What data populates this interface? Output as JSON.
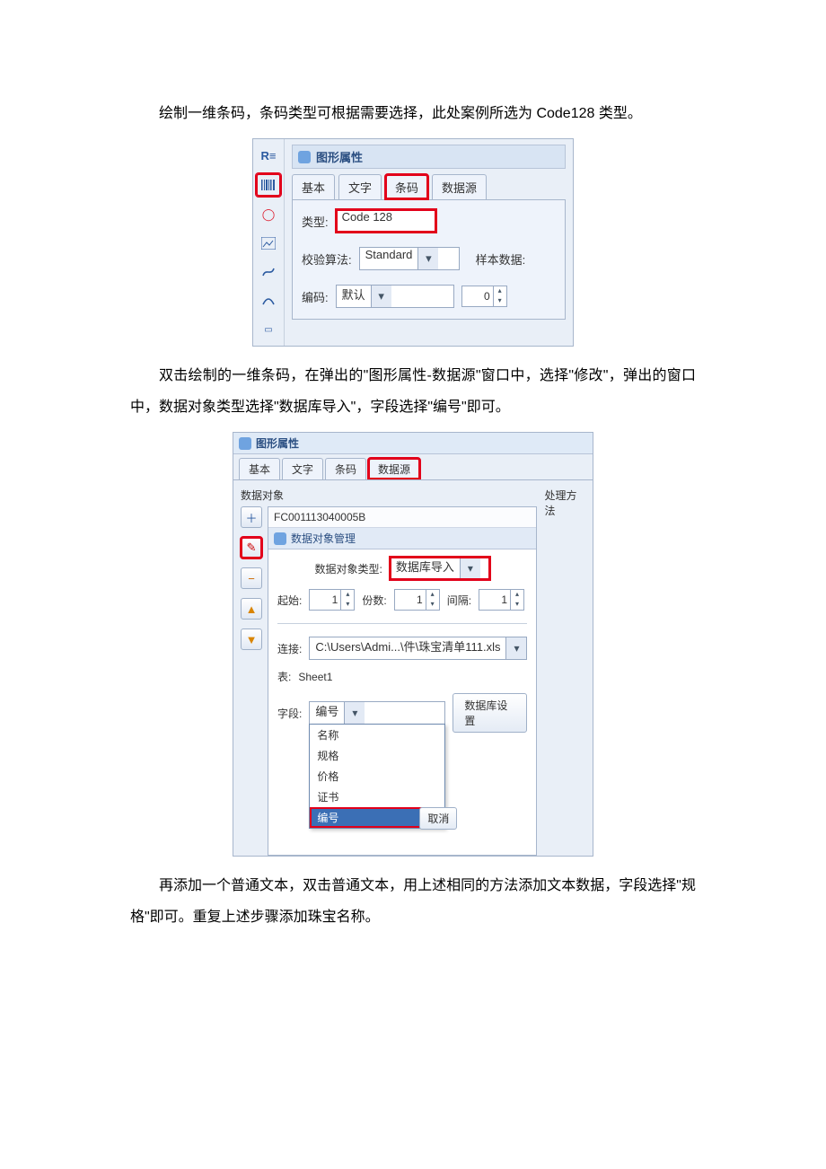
{
  "para1": "绘制一维条码，条码类型可根据需要选择，此处案例所选为 Code128 类型。",
  "para2": "双击绘制的一维条码，在弹出的\"图形属性-数据源\"窗口中，选择\"修改\"，弹出的窗口中，数据对象类型选择\"数据库导入\"，字段选择\"编号\"即可。",
  "para3": "再添加一个普通文本，双击普通文本，用上述相同的方法添加文本数据，字段选择\"规格\"即可。重复上述步骤添加珠宝名称。",
  "shot1": {
    "title": "图形属性",
    "tabs": {
      "basic": "基本",
      "text": "文字",
      "barcode": "条码",
      "datasrc": "数据源"
    },
    "typeLabel": "类型:",
    "typeValue": "Code 128",
    "checksumLabel": "校验算法:",
    "checksumValue": "Standard",
    "sampleLabel": "样本数据:",
    "encodeLabel": "编码:",
    "encodeValue": "默认",
    "encodeNum": "0"
  },
  "shot2": {
    "title": "图形属性",
    "tabs": {
      "basic": "基本",
      "text": "文字",
      "barcode": "条码",
      "datasrc": "数据源"
    },
    "dataObjLabel": "数据对象",
    "methodLabel": "处理方法",
    "value": "FC001113040005B",
    "subTitle": "数据对象管理",
    "objTypeLabel": "数据对象类型:",
    "objTypeValue": "数据库导入",
    "startLabel": "起始:",
    "startVal": "1",
    "countLabel": "份数:",
    "countVal": "1",
    "gapLabel": "间隔:",
    "gapVal": "1",
    "connLabel": "连接:",
    "connValue": "C:\\Users\\Admi...\\件\\珠宝清单111.xls",
    "tableLabel": "表:",
    "tableValue": "Sheet1",
    "fieldLabel": "字段:",
    "fieldValue": "编号",
    "dbSetBtn": "数据库设置",
    "cancelBtn": "取消",
    "options": [
      "名称",
      "规格",
      "价格",
      "证书",
      "编号"
    ]
  }
}
